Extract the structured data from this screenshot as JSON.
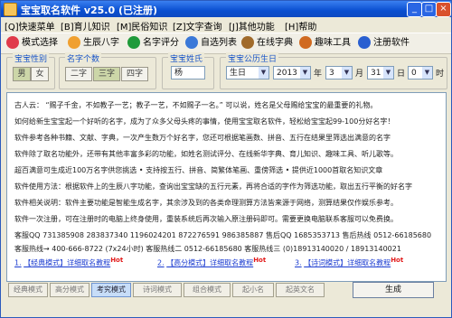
{
  "window": {
    "title": "宝宝取名软件 v25.0 (已注册)"
  },
  "menu": [
    {
      "label": "[Q]快速菜单"
    },
    {
      "label": "[B]育儿知识"
    },
    {
      "label": "[M]民俗知识"
    },
    {
      "label": "[Z]文字查询"
    },
    {
      "label": "[J]其他功能"
    },
    {
      "label": "[H]帮助"
    }
  ],
  "toolbar": [
    {
      "label": "模式选择",
      "icon": "heart-icon",
      "color": "#e03a4a"
    },
    {
      "label": "生辰八字",
      "icon": "house-icon",
      "color": "#f0a030"
    },
    {
      "label": "名字评分",
      "icon": "arrow-icon",
      "color": "#1f9a3a"
    },
    {
      "label": "自选列表",
      "icon": "list-icon",
      "color": "#3a78d8"
    },
    {
      "label": "在线字典",
      "icon": "book-icon",
      "color": "#a06a2a"
    },
    {
      "label": "趣味工具",
      "icon": "tool-icon",
      "color": "#d06a20"
    },
    {
      "label": "注册软件",
      "icon": "register-icon",
      "color": "#2a5fd0"
    }
  ],
  "controls": {
    "gender": {
      "label": "宝宝性别",
      "options": [
        "男",
        "女"
      ],
      "selected": "男"
    },
    "count": {
      "label": "名字个数",
      "options": [
        "二字",
        "三字",
        "四字"
      ],
      "selected": "三字"
    },
    "surname": {
      "label": "宝宝姓氏",
      "value": "杨"
    },
    "birthday": {
      "label": "宝宝公历生日",
      "calendar": "生日",
      "year": "2013",
      "year_unit": "年",
      "month": "3",
      "month_unit": "月",
      "day": "31",
      "day_unit": "日",
      "hour": "0",
      "hour_unit": "时"
    }
  },
  "intro_lines": [
    "古人云：  “赐子千金，不如教子一艺；教子一艺，不如赐子一名。”  可以说，姓名是父母赐给宝宝的最重要的礼物。",
    "如何给新生宝宝起一个好听的名字，成为了众多父母头疼的事情，使用宝宝取名软件，轻松给宝宝起99-100分好名字！",
    "软件参考各种书籍、文献、字典，一次产生数万个好名字，您还可根据笔画数、拼音、五行在结果里筛选出满意的名字",
    "软件除了取名功能外，还带有其他丰富多彩的功能，如姓名测试评分、在线新华字典、育儿知识、趣味工具、听儿歌等。",
    "超百满意可生成近100万名字供您挑选    • 支持按五行、拼音、简繁体笔画、重傍筛选  • 提供近1000首取名知识文章",
    "软件使用方法：根据软件上的生辰八字功能，查询出宝宝缺的五行元素，再将合适的字作为筛选功能，取出五行平衡的好名字",
    "软件相关说明：软件主要功能是智能生成名字，其余涉及到的各类命理测算方法皆来源于网络，测算结果仅作娱乐参考。",
    "软件一次注册，可在注册时的电脑上终身使用，重装系统后再次输入原注册码即可。需要更换电脑联系客服可以免费换。",
    "客服QQ 731385908  283837340  1196024201  872276591  986385887  售后QQ 1685353713  售后热线 0512-66185680",
    "客服热线→ 400-666-8722 (7x24小时)  客服热线二 0512-66185680  客服热线三 (0)18913140020 / 18913140021"
  ],
  "guide_links": [
    {
      "num": "1.",
      "text": "【经典模式】详细取名教程",
      "hot": "Hot"
    },
    {
      "num": "2.",
      "text": "【高分模式】详细取名教程",
      "hot": "Hot"
    },
    {
      "num": "3.",
      "text": "【诗词模式】详细取名教程",
      "hot": "Hot"
    }
  ],
  "modes": [
    {
      "label": "经典模式",
      "active": false
    },
    {
      "label": "高分模式",
      "active": false
    },
    {
      "label": "考究模式",
      "active": true
    },
    {
      "label": "诗词模式",
      "active": false
    },
    {
      "label": "组合模式",
      "active": false
    },
    {
      "label": "起小名",
      "active": false
    },
    {
      "label": "起英文名",
      "active": false
    }
  ],
  "generate_label": "生成"
}
